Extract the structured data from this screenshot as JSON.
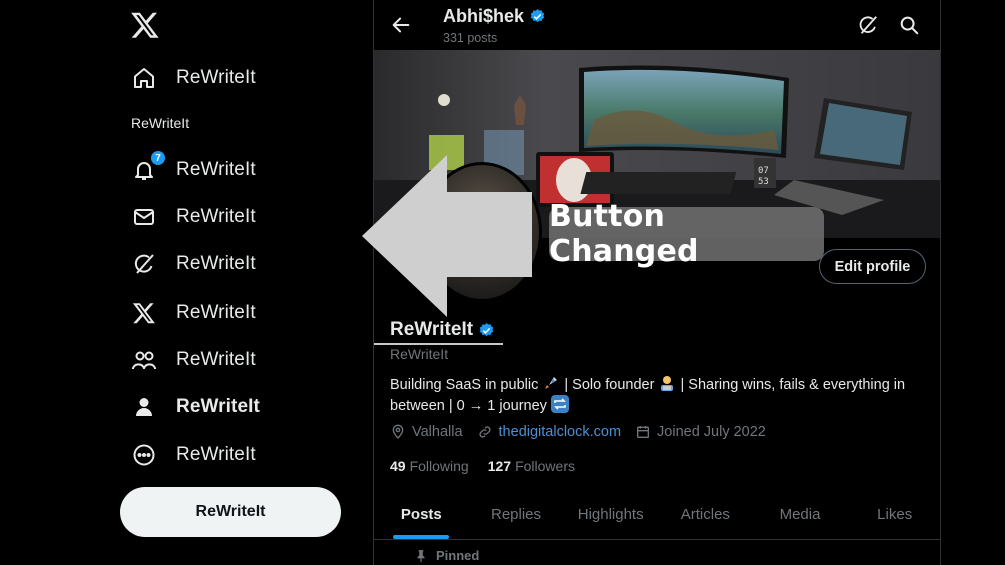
{
  "sidebar": {
    "items": [
      {
        "icon": "home-icon",
        "label": "ReWriteIt"
      },
      {
        "icon": "notifications-icon",
        "label": "ReWriteIt",
        "badge": "7"
      },
      {
        "icon": "messages-icon",
        "label": "ReWriteIt"
      },
      {
        "icon": "grok-icon",
        "label": "ReWriteIt"
      },
      {
        "icon": "x-premium-icon",
        "label": "ReWriteIt"
      },
      {
        "icon": "communities-icon",
        "label": "ReWriteIt"
      },
      {
        "icon": "profile-icon",
        "label": "ReWriteIt"
      },
      {
        "icon": "more-icon",
        "label": "ReWriteIt"
      }
    ],
    "section_label": "ReWriteIt",
    "post_button": "ReWriteIt"
  },
  "header": {
    "name": "Abhi$hek",
    "posts": "331 posts"
  },
  "profile": {
    "edit_button": "Edit profile",
    "name": "ReWriteIt",
    "handle": "ReWriteIt",
    "bio_line1_a": "Building SaaS in public",
    "bio_line1_b": "| Solo founder",
    "bio_line1_c": "| Sharing wins, fails & everything in",
    "bio_line2": "between | 0 → 1 journey",
    "location": "Valhalla",
    "link": "thedigitalclock.com",
    "joined": "Joined July 2022",
    "following_count": "49",
    "following_label": "Following",
    "followers_count": "127",
    "followers_label": "Followers"
  },
  "tabs": [
    "Posts",
    "Replies",
    "Highlights",
    "Articles",
    "Media",
    "Likes"
  ],
  "pinned_label": "Pinned",
  "annotation": "Button Changed",
  "colors": {
    "accent": "#1d9bf0",
    "link": "#4d8fd4",
    "muted": "#71767b",
    "background": "#000000"
  }
}
